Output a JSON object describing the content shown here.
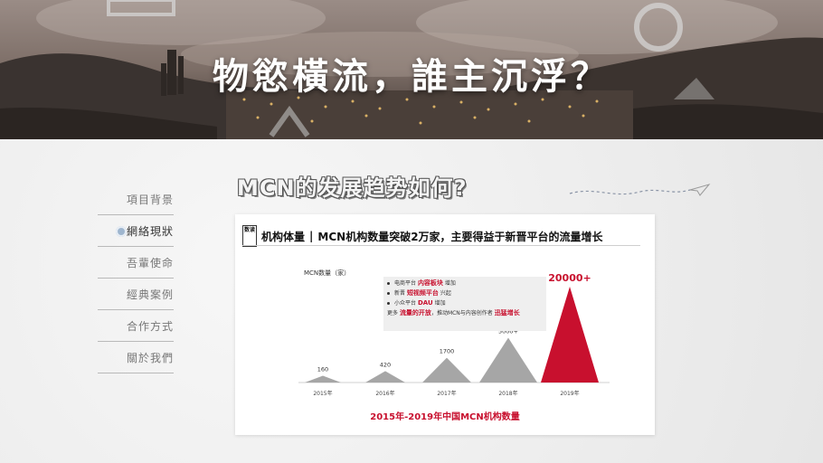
{
  "hero": {
    "title": "物慾橫流，誰主沉浮？"
  },
  "nav": {
    "items": [
      {
        "label": "項目背景",
        "active": false
      },
      {
        "label": "網絡現狀",
        "active": true
      },
      {
        "label": "吾輩使命",
        "active": false
      },
      {
        "label": "經典案例",
        "active": false
      },
      {
        "label": "合作方式",
        "active": false
      },
      {
        "label": "關於我們",
        "active": false
      }
    ]
  },
  "section": {
    "title": "MCN的发展趋势如何?"
  },
  "card": {
    "tag": "数读",
    "title_a": "机构体量",
    "title_b": "MCN机构数量突破2万家，主要得益于新晋平台的流量增长",
    "note": {
      "line1_pre": "电商平台",
      "line1_red": "内容板块",
      "line1_post": "增加",
      "line2_pre": "新晋",
      "line2_red": "短视频平台",
      "line2_post": "兴起",
      "line3_pre": "小众平台",
      "line3_red": "DAU",
      "line3_post": "增加",
      "line4_pre": "更多",
      "line4_red1": "流量的开放",
      "line4_mid": "，推动MCN与内容创作者",
      "line4_red2": "迅猛增长"
    },
    "caption": "2015年-2019年中国MCN机构数量"
  },
  "colors": {
    "accent": "#c8102e",
    "gray_peak": "#a6a6a6"
  },
  "chart_data": {
    "type": "area",
    "title": "",
    "ylabel": "MCN数量（家）",
    "categories": [
      "2015年",
      "2016年",
      "2017年",
      "2018年",
      "2019年"
    ],
    "values": [
      160,
      420,
      1700,
      5000,
      20000
    ],
    "data_labels": [
      "160",
      "420",
      "1700",
      "5000+",
      "20000+"
    ],
    "highlight_index": 4,
    "ylim": [
      0,
      20000
    ]
  }
}
